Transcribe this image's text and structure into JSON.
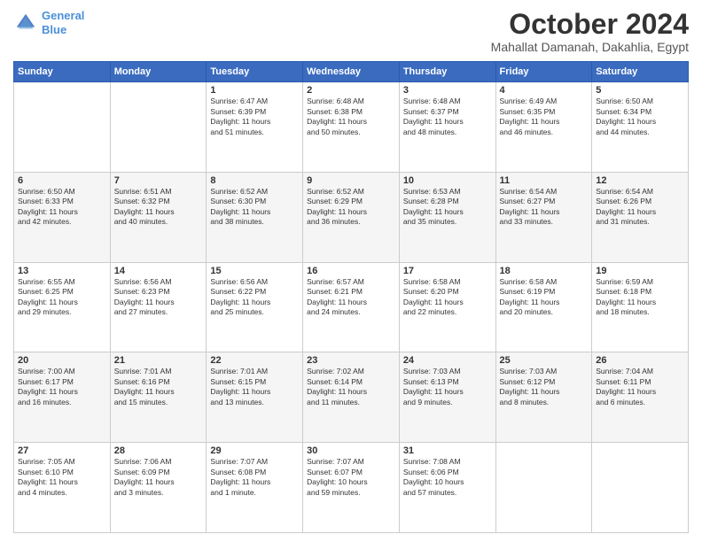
{
  "logo": {
    "line1": "General",
    "line2": "Blue"
  },
  "title": "October 2024",
  "location": "Mahallat Damanah, Dakahlia, Egypt",
  "days": [
    "Sunday",
    "Monday",
    "Tuesday",
    "Wednesday",
    "Thursday",
    "Friday",
    "Saturday"
  ],
  "weeks": [
    [
      {
        "day": "",
        "content": ""
      },
      {
        "day": "",
        "content": ""
      },
      {
        "day": "1",
        "content": "Sunrise: 6:47 AM\nSunset: 6:39 PM\nDaylight: 11 hours\nand 51 minutes."
      },
      {
        "day": "2",
        "content": "Sunrise: 6:48 AM\nSunset: 6:38 PM\nDaylight: 11 hours\nand 50 minutes."
      },
      {
        "day": "3",
        "content": "Sunrise: 6:48 AM\nSunset: 6:37 PM\nDaylight: 11 hours\nand 48 minutes."
      },
      {
        "day": "4",
        "content": "Sunrise: 6:49 AM\nSunset: 6:35 PM\nDaylight: 11 hours\nand 46 minutes."
      },
      {
        "day": "5",
        "content": "Sunrise: 6:50 AM\nSunset: 6:34 PM\nDaylight: 11 hours\nand 44 minutes."
      }
    ],
    [
      {
        "day": "6",
        "content": "Sunrise: 6:50 AM\nSunset: 6:33 PM\nDaylight: 11 hours\nand 42 minutes."
      },
      {
        "day": "7",
        "content": "Sunrise: 6:51 AM\nSunset: 6:32 PM\nDaylight: 11 hours\nand 40 minutes."
      },
      {
        "day": "8",
        "content": "Sunrise: 6:52 AM\nSunset: 6:30 PM\nDaylight: 11 hours\nand 38 minutes."
      },
      {
        "day": "9",
        "content": "Sunrise: 6:52 AM\nSunset: 6:29 PM\nDaylight: 11 hours\nand 36 minutes."
      },
      {
        "day": "10",
        "content": "Sunrise: 6:53 AM\nSunset: 6:28 PM\nDaylight: 11 hours\nand 35 minutes."
      },
      {
        "day": "11",
        "content": "Sunrise: 6:54 AM\nSunset: 6:27 PM\nDaylight: 11 hours\nand 33 minutes."
      },
      {
        "day": "12",
        "content": "Sunrise: 6:54 AM\nSunset: 6:26 PM\nDaylight: 11 hours\nand 31 minutes."
      }
    ],
    [
      {
        "day": "13",
        "content": "Sunrise: 6:55 AM\nSunset: 6:25 PM\nDaylight: 11 hours\nand 29 minutes."
      },
      {
        "day": "14",
        "content": "Sunrise: 6:56 AM\nSunset: 6:23 PM\nDaylight: 11 hours\nand 27 minutes."
      },
      {
        "day": "15",
        "content": "Sunrise: 6:56 AM\nSunset: 6:22 PM\nDaylight: 11 hours\nand 25 minutes."
      },
      {
        "day": "16",
        "content": "Sunrise: 6:57 AM\nSunset: 6:21 PM\nDaylight: 11 hours\nand 24 minutes."
      },
      {
        "day": "17",
        "content": "Sunrise: 6:58 AM\nSunset: 6:20 PM\nDaylight: 11 hours\nand 22 minutes."
      },
      {
        "day": "18",
        "content": "Sunrise: 6:58 AM\nSunset: 6:19 PM\nDaylight: 11 hours\nand 20 minutes."
      },
      {
        "day": "19",
        "content": "Sunrise: 6:59 AM\nSunset: 6:18 PM\nDaylight: 11 hours\nand 18 minutes."
      }
    ],
    [
      {
        "day": "20",
        "content": "Sunrise: 7:00 AM\nSunset: 6:17 PM\nDaylight: 11 hours\nand 16 minutes."
      },
      {
        "day": "21",
        "content": "Sunrise: 7:01 AM\nSunset: 6:16 PM\nDaylight: 11 hours\nand 15 minutes."
      },
      {
        "day": "22",
        "content": "Sunrise: 7:01 AM\nSunset: 6:15 PM\nDaylight: 11 hours\nand 13 minutes."
      },
      {
        "day": "23",
        "content": "Sunrise: 7:02 AM\nSunset: 6:14 PM\nDaylight: 11 hours\nand 11 minutes."
      },
      {
        "day": "24",
        "content": "Sunrise: 7:03 AM\nSunset: 6:13 PM\nDaylight: 11 hours\nand 9 minutes."
      },
      {
        "day": "25",
        "content": "Sunrise: 7:03 AM\nSunset: 6:12 PM\nDaylight: 11 hours\nand 8 minutes."
      },
      {
        "day": "26",
        "content": "Sunrise: 7:04 AM\nSunset: 6:11 PM\nDaylight: 11 hours\nand 6 minutes."
      }
    ],
    [
      {
        "day": "27",
        "content": "Sunrise: 7:05 AM\nSunset: 6:10 PM\nDaylight: 11 hours\nand 4 minutes."
      },
      {
        "day": "28",
        "content": "Sunrise: 7:06 AM\nSunset: 6:09 PM\nDaylight: 11 hours\nand 3 minutes."
      },
      {
        "day": "29",
        "content": "Sunrise: 7:07 AM\nSunset: 6:08 PM\nDaylight: 11 hours\nand 1 minute."
      },
      {
        "day": "30",
        "content": "Sunrise: 7:07 AM\nSunset: 6:07 PM\nDaylight: 10 hours\nand 59 minutes."
      },
      {
        "day": "31",
        "content": "Sunrise: 7:08 AM\nSunset: 6:06 PM\nDaylight: 10 hours\nand 57 minutes."
      },
      {
        "day": "",
        "content": ""
      },
      {
        "day": "",
        "content": ""
      }
    ]
  ]
}
